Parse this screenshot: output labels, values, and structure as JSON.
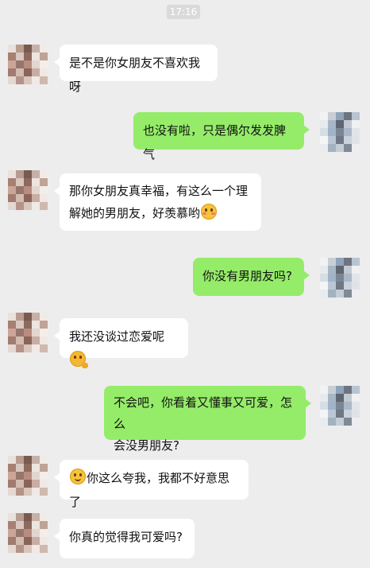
{
  "timestamp": "17:16",
  "messages": [
    {
      "side": "left",
      "text": "是不是你女朋友不喜欢我呀"
    },
    {
      "side": "right",
      "text": "也没有啦，只是偶尔发发脾气"
    },
    {
      "side": "left",
      "line1": "那你女朋友真幸福，有这么一个理",
      "line2": "解她的男朋友，好羡慕哟",
      "emoji": "shy-face-icon"
    },
    {
      "side": "right",
      "text": "你没有男朋友吗?"
    },
    {
      "side": "left",
      "text": "我还没谈过恋爱呢",
      "emoji": "thinking-face-icon"
    },
    {
      "side": "right",
      "line1": "不会吧，你看着又懂事又可爱，怎么",
      "line2": "会没男朋友?"
    },
    {
      "side": "left",
      "text": "你这么夸我，我都不好意思了",
      "emoji": "smiling-face-icon"
    },
    {
      "side": "left",
      "text": "你真的觉得我可爱吗?"
    }
  ],
  "colors": {
    "background": "#ededed",
    "bubble_left": "#ffffff",
    "bubble_right": "#95ec69"
  }
}
